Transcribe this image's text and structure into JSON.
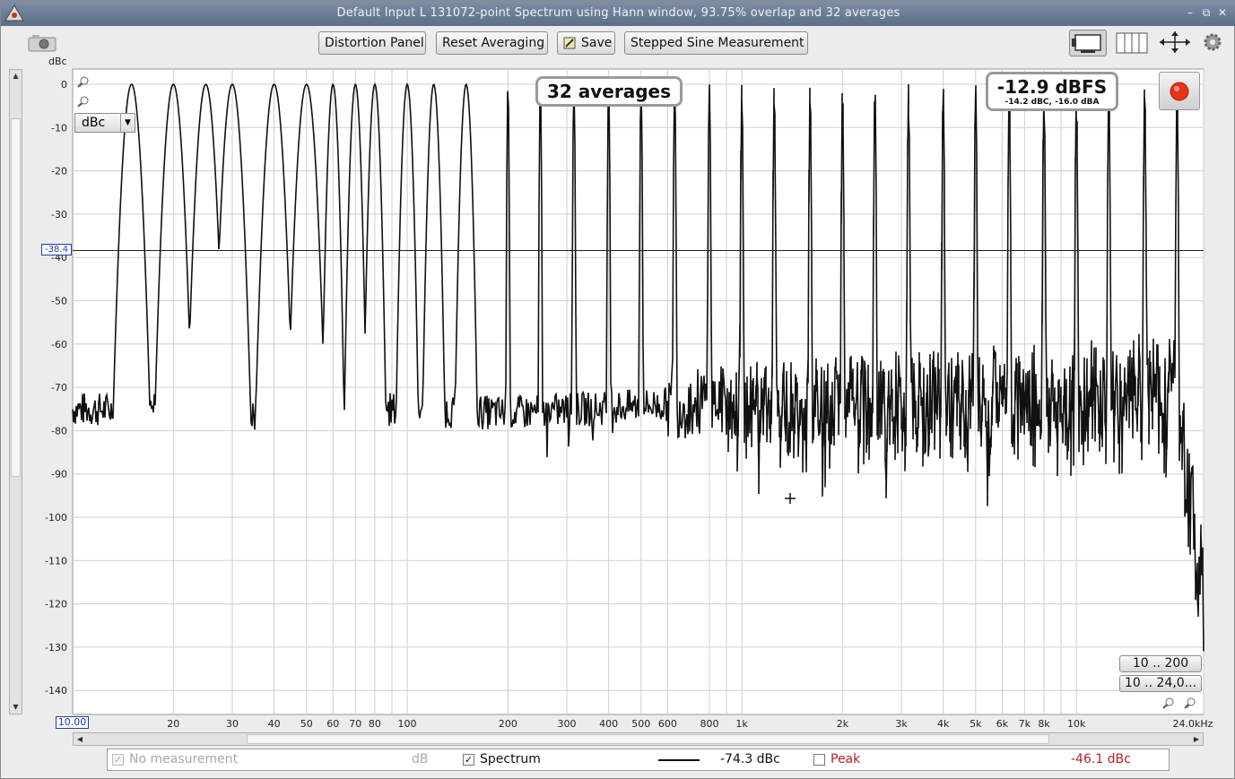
{
  "window": {
    "title": "Default Input L 131072-point Spectrum using Hann window, 93.75% overlap and 32 averages",
    "controls": [
      "–",
      "⧉",
      "✕"
    ]
  },
  "toolbar": {
    "distortion_label": "Distortion Panel",
    "reset_label": "Reset Averaging",
    "save_label": "Save",
    "stepped_label": "Stepped Sine Measurement"
  },
  "plot": {
    "unit_label": "dBc",
    "unit_select": "dBc",
    "averages_badge": "32 averages",
    "level_main": "-12.9 dBFS",
    "level_sub": "-14.2 dBC, -16.0 dBA",
    "cursor_marker": "-38.4",
    "x_start_label": "10.00",
    "range_buttons": [
      "10 .. 200",
      "10 .. 24,0..."
    ]
  },
  "legend": {
    "no_meas_label": "No measurement",
    "no_meas_unit": "dB",
    "spectrum_label": "Spectrum",
    "spectrum_value": "-74.3 dBc",
    "peak_label": "Peak",
    "peak_value": "-46.1 dBc"
  },
  "colors": {
    "accent": "#1a1a1a",
    "peak": "#b0202a",
    "marker": "#1f3ea8",
    "record": "#e8321a"
  },
  "chart_data": {
    "type": "line",
    "x_scale": "log",
    "xlim": [
      10,
      24000
    ],
    "ylim": [
      -145,
      3
    ],
    "x_ticks": [
      {
        "v": 20,
        "label": "20"
      },
      {
        "v": 30,
        "label": "30"
      },
      {
        "v": 40,
        "label": "40"
      },
      {
        "v": 50,
        "label": "50"
      },
      {
        "v": 60,
        "label": "60"
      },
      {
        "v": 70,
        "label": "70"
      },
      {
        "v": 80,
        "label": "80"
      },
      {
        "v": 100,
        "label": "100"
      },
      {
        "v": 200,
        "label": "200"
      },
      {
        "v": 300,
        "label": "300"
      },
      {
        "v": 400,
        "label": "400"
      },
      {
        "v": 500,
        "label": "500"
      },
      {
        "v": 600,
        "label": "600"
      },
      {
        "v": 800,
        "label": "800"
      },
      {
        "v": 1000,
        "label": "1k"
      },
      {
        "v": 2000,
        "label": "2k"
      },
      {
        "v": 3000,
        "label": "3k"
      },
      {
        "v": 4000,
        "label": "4k"
      },
      {
        "v": 5000,
        "label": "5k"
      },
      {
        "v": 6000,
        "label": "6k"
      },
      {
        "v": 7000,
        "label": "7k"
      },
      {
        "v": 8000,
        "label": "8k"
      },
      {
        "v": 10000,
        "label": "10k"
      },
      {
        "v": 24000,
        "label": "24.0kHz"
      }
    ],
    "x_minor": [
      90,
      900,
      9000
    ],
    "y_ticks": [
      0,
      -10,
      -20,
      -30,
      -40,
      -50,
      -60,
      -70,
      -80,
      -90,
      -100,
      -110,
      -120,
      -130,
      -140
    ],
    "cursor_level": -38.4,
    "tone_peaks_hz": [
      15,
      20,
      25,
      30,
      40,
      50,
      60,
      70,
      80,
      100,
      120,
      150,
      200,
      250,
      315,
      400,
      500,
      630,
      800,
      1000,
      1250,
      1600,
      2000,
      2500,
      3150,
      4000,
      5000,
      6300,
      8000,
      10000,
      12500,
      16000,
      20000
    ],
    "tone_peak_level": 0,
    "noise_floor_dbc": [
      {
        "f": 10,
        "db": -75
      },
      {
        "f": 50,
        "db": -76
      },
      {
        "f": 100,
        "db": -75
      },
      {
        "f": 200,
        "db": -76
      },
      {
        "f": 1000,
        "db": -73
      },
      {
        "f": 5000,
        "db": -72
      },
      {
        "f": 20000,
        "db": -71
      },
      {
        "f": 24000,
        "db": -120
      }
    ],
    "series": [
      {
        "values": []
      }
    ]
  }
}
